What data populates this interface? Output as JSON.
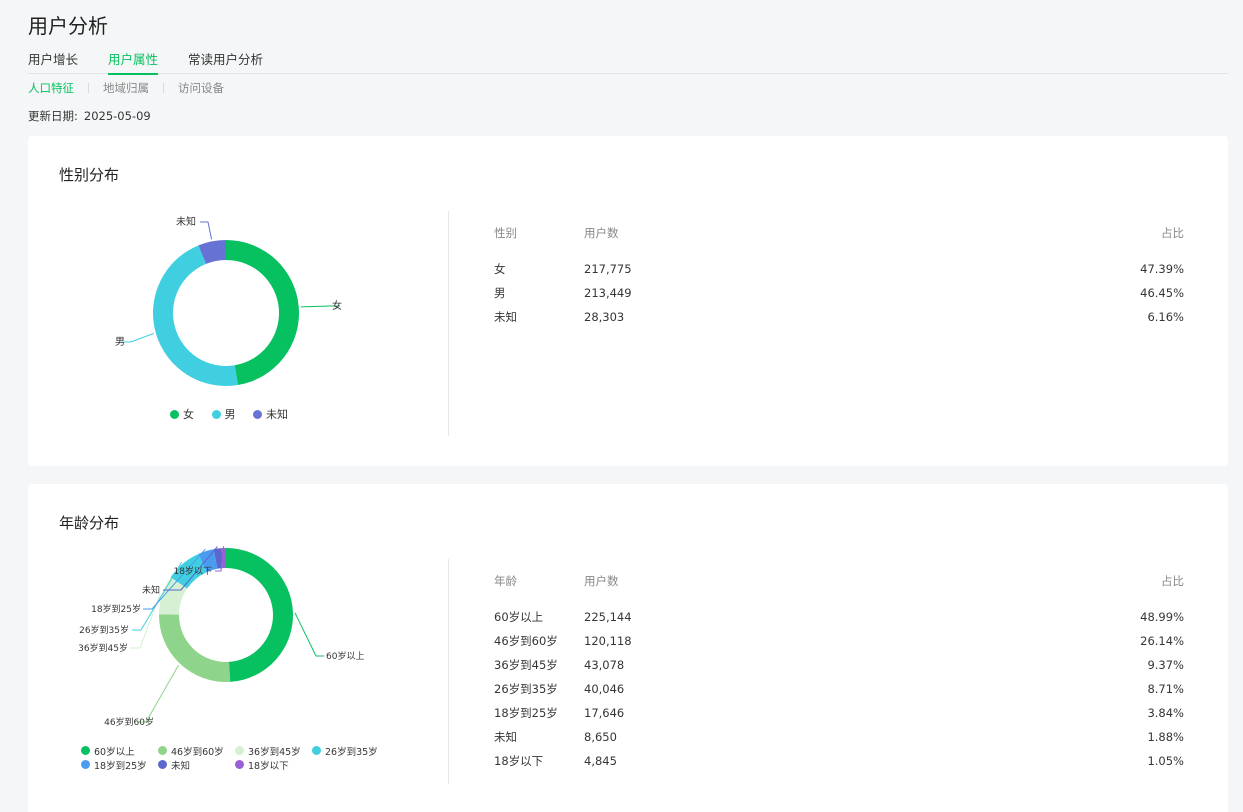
{
  "page": {
    "title": "用户分析"
  },
  "tabs": [
    "用户增长",
    "用户属性",
    "常读用户分析"
  ],
  "active_tab": 1,
  "subtabs": [
    "人口特征",
    "地域归属",
    "访问设备"
  ],
  "active_subtab": 0,
  "update": {
    "label": "更新日期:",
    "date": "2025-05-09"
  },
  "gender": {
    "title": "性别分布",
    "table_headers": [
      "性别",
      "用户数",
      "占比"
    ],
    "rows": [
      {
        "name": "女",
        "count": "217,775",
        "pct": "47.39%"
      },
      {
        "name": "男",
        "count": "213,449",
        "pct": "46.45%"
      },
      {
        "name": "未知",
        "count": "28,303",
        "pct": "6.16%"
      }
    ]
  },
  "age": {
    "title": "年龄分布",
    "table_headers": [
      "年龄",
      "用户数",
      "占比"
    ],
    "rows": [
      {
        "name": "60岁以上",
        "count": "225,144",
        "pct": "48.99%"
      },
      {
        "name": "46岁到60岁",
        "count": "120,118",
        "pct": "26.14%"
      },
      {
        "name": "36岁到45岁",
        "count": "43,078",
        "pct": "9.37%"
      },
      {
        "name": "26岁到35岁",
        "count": "40,046",
        "pct": "8.71%"
      },
      {
        "name": "18岁到25岁",
        "count": "17,646",
        "pct": "3.84%"
      },
      {
        "name": "未知",
        "count": "8,650",
        "pct": "1.88%"
      },
      {
        "name": "18岁以下",
        "count": "4,845",
        "pct": "1.05%"
      }
    ]
  },
  "chart_data": [
    {
      "type": "pie",
      "categories": [
        "女",
        "男",
        "未知"
      ],
      "values": [
        47.39,
        46.45,
        6.16
      ],
      "colors": [
        "#07c160",
        "#40cfe0",
        "#6673d4"
      ],
      "legend_position": "bottom"
    },
    {
      "type": "pie",
      "categories": [
        "60岁以上",
        "46岁到60岁",
        "36岁到45岁",
        "26岁到35岁",
        "18岁到25岁",
        "未知",
        "18岁以下"
      ],
      "values": [
        48.99,
        26.14,
        9.37,
        8.71,
        3.84,
        1.88,
        1.05
      ],
      "colors": [
        "#07c160",
        "#8ed48a",
        "#d5f0d2",
        "#40cfe0",
        "#4a9cf0",
        "#5b66cf",
        "#9b5fd6"
      ],
      "legend_position": "bottom"
    }
  ]
}
